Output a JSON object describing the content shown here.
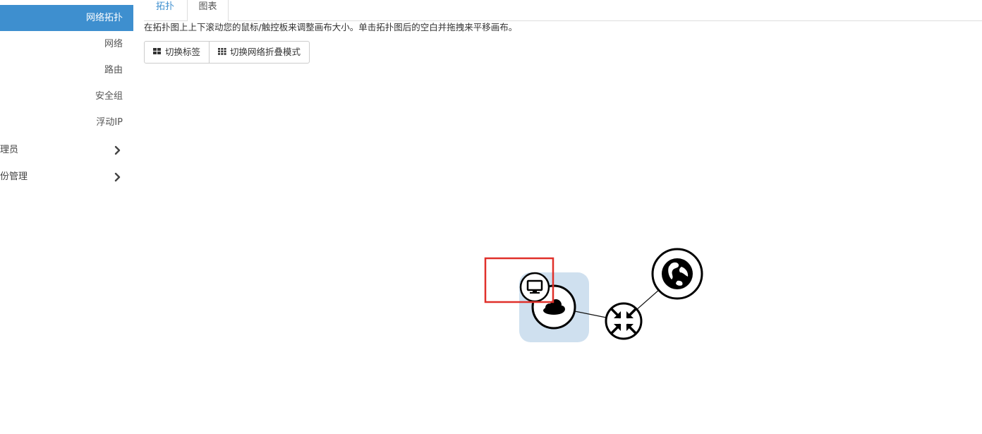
{
  "sidebar": {
    "active_item": "网络拓扑",
    "items": [
      "网络",
      "路由",
      "安全组",
      "浮动IP"
    ],
    "groups": [
      {
        "label": "理员",
        "icon": "chevron-right-icon"
      },
      {
        "label": "份管理",
        "icon": "chevron-right-icon"
      }
    ]
  },
  "tabs": {
    "topology": "拓扑",
    "chart": "图表"
  },
  "hint": "在拓扑图上上下滚动您的鼠标/触控板来调整画布大小。单击拓扑图后的空白并拖拽来平移画布。",
  "buttons": {
    "toggle_labels": "切换标签",
    "toggle_labels_icon": "th-large-icon",
    "toggle_collapse": "切换网络折叠模式",
    "toggle_collapse_icon": "th-icon"
  },
  "topology": {
    "nodes": [
      {
        "name": "instance-node",
        "icon": "desktop-icon"
      },
      {
        "name": "network-node",
        "icon": "cloud-icon"
      },
      {
        "name": "router-node",
        "icon": "compress-arrows-icon"
      },
      {
        "name": "external-network-node",
        "icon": "globe-icon"
      }
    ],
    "colors": {
      "network_highlight": "#cfe0ef",
      "selection_box": "#e0302a",
      "node_stroke": "#000000",
      "active_blue": "#3e8fcf"
    }
  }
}
